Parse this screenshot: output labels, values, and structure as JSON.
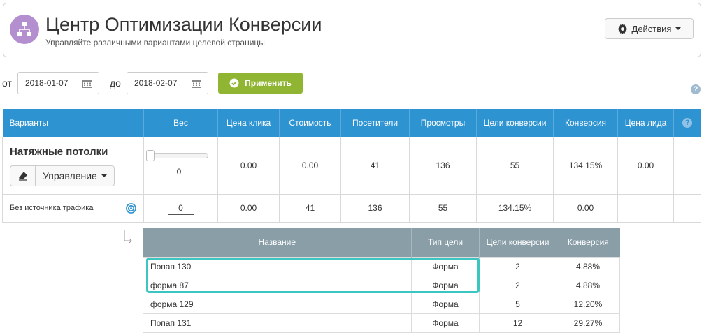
{
  "header": {
    "title": "Центр Оптимизации Конверсии",
    "subtitle": "Управляйте различными вариантами целевой страницы",
    "actions_label": "Действия"
  },
  "filters": {
    "from_label": "от",
    "from_value": "2018-01-07",
    "to_label": "до",
    "to_value": "2018-02-07",
    "apply_label": "Применить"
  },
  "main_table": {
    "headers": [
      "Варианты",
      "Вес",
      "Цена клика",
      "Стоимость",
      "Посетители",
      "Просмотры",
      "Цели конверсии",
      "Конверсия",
      "Цена лида",
      "?"
    ],
    "variant": {
      "name": "Натяжные потолки",
      "manage_label": "Управление",
      "weight": "0",
      "cpc": "0.00",
      "cost": "0.00",
      "visitors": "41",
      "views": "136",
      "goals": "55",
      "conversion": "134.15%",
      "lead_price": "0.00"
    },
    "source": {
      "label": "Без источника трафика",
      "cpc_input": "0",
      "cost": "0.00",
      "visitors": "41",
      "views": "136",
      "goals": "55",
      "conversion": "134.15%",
      "lead_price": "0.00"
    }
  },
  "sub_table": {
    "headers": [
      "Название",
      "Тип цели",
      "Цели конверсии",
      "Конверсия"
    ],
    "rows": [
      {
        "name": "Попап 130",
        "type": "Форма",
        "goals": "2",
        "conversion": "4.88%"
      },
      {
        "name": "форма 87",
        "type": "Форма",
        "goals": "2",
        "conversion": "4.88%"
      },
      {
        "name": "форма 129",
        "type": "Форма",
        "goals": "5",
        "conversion": "12.20%"
      },
      {
        "name": "Попап 131",
        "type": "Форма",
        "goals": "12",
        "conversion": "29.27%"
      }
    ]
  },
  "colors": {
    "header_blue": "#2e93d1",
    "subheader_gray": "#8a9ea8",
    "apply_green": "#8fb532",
    "highlight_teal": "#3cc6c2",
    "logo_purple": "#b48fd0"
  },
  "icons": [
    "sitemap-icon",
    "gear-icon",
    "calendar-icon",
    "check-circle-icon",
    "help-icon",
    "eraser-icon",
    "target-icon",
    "corner-arrow-icon"
  ]
}
